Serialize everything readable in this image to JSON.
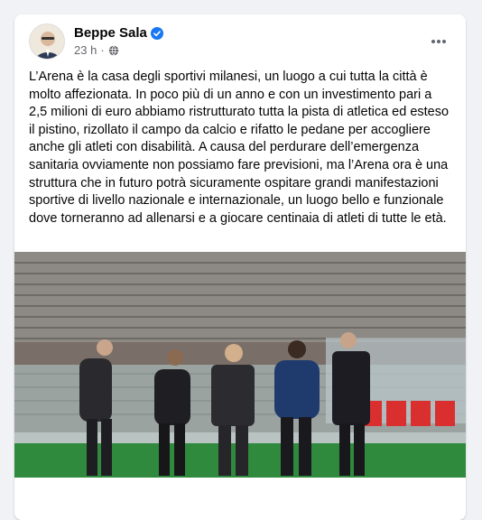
{
  "post": {
    "author": "Beppe Sala",
    "time": "23 h",
    "separator": "·",
    "text": "L’Arena è la casa degli sportivi milanesi, un luogo a cui tutta la città è molto affezionata. In poco più di un anno e con un investimento pari a 2,5 milioni di euro abbiamo ristrutturato tutta la pista di atletica ed esteso il pistino, rizollato il campo da calcio e rifatto le pedane per accogliere anche gli atleti con disabilità. A causa del perdurare dell’emergenza sanitaria ovviamente non possiamo fare previsioni, ma l’Arena ora è una struttura che in futuro potrà sicuramente ospitare grandi manifestazioni sportive di livello nazionale e internazionale, un luogo bello e funzionale dove torneranno ad allenarsi e a giocare centinaia di atleti di tutte le età."
  },
  "icons": {
    "verified": "verified-badge-icon",
    "audience": "globe-icon",
    "menu": "more-horizontal-icon"
  },
  "colors": {
    "background": "#f0f2f5",
    "card": "#ffffff",
    "primary_text": "#050505",
    "secondary_text": "#65676b",
    "verified_blue": "#1877f2"
  }
}
